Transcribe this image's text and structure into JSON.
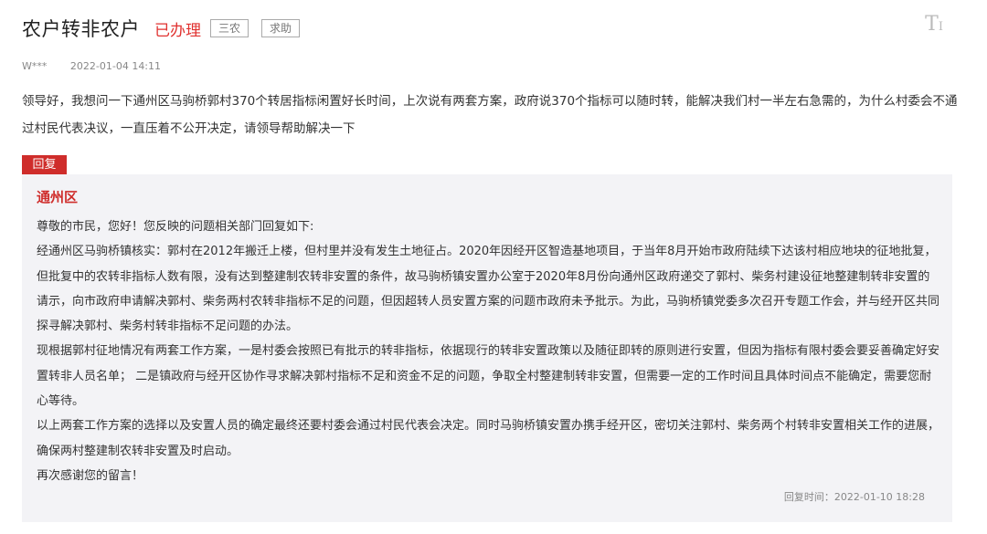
{
  "header": {
    "title": "农户转非农户",
    "status": "已办理",
    "tags": [
      "三农",
      "求助"
    ],
    "font_tool": "T"
  },
  "meta": {
    "author": "W***",
    "date": "2022-01-04 14:11"
  },
  "question": "领导好，我想问一下通州区马驹桥郭村370个转居指标闲置好长时间，上次说有两套方案，政府说370个指标可以随时转，能解决我们村一半左右急需的，为什么村委会不通过村民代表决议，一直压着不公开决定，请领导帮助解决一下",
  "reply": {
    "badge": "回复",
    "department": "通州区",
    "paragraphs": [
      "尊敬的市民，您好！您反映的问题相关部门回复如下:",
      "经通州区马驹桥镇核实：郭村在2012年搬迁上楼，但村里并没有发生土地征占。2020年因经开区智造基地项目，于当年8月开始市政府陆续下达该村相应地块的征地批复，但批复中的农转非指标人数有限，没有达到整建制农转非安置的条件，故马驹桥镇安置办公室于2020年8月份向通州区政府递交了郭村、柴务村建设征地整建制转非安置的请示，向市政府申请解决郭村、柴务两村农转非指标不足的问题，但因超转人员安置方案的问题市政府未予批示。为此，马驹桥镇党委多次召开专题工作会，并与经开区共同探寻解决郭村、柴务村转非指标不足问题的办法。",
      "现根据郭村征地情况有两套工作方案，一是村委会按照已有批示的转非指标，依据现行的转非安置政策以及随征即转的原则进行安置，但因为指标有限村委会要妥善确定好安置转非人员名单； 二是镇政府与经开区协作寻求解决郭村指标不足和资金不足的问题，争取全村整建制转非安置，但需要一定的工作时间且具体时间点不能确定，需要您耐心等待。",
      "以上两套工作方案的选择以及安置人员的确定最终还要村委会通过村民代表会决定。同时马驹桥镇安置办携手经开区，密切关注郭村、柴务两个村转非安置相关工作的进展，确保两村整建制农转非安置及时启动。",
      "再次感谢您的留言！"
    ],
    "time_label": "回复时间：2022-01-10 18:28"
  }
}
